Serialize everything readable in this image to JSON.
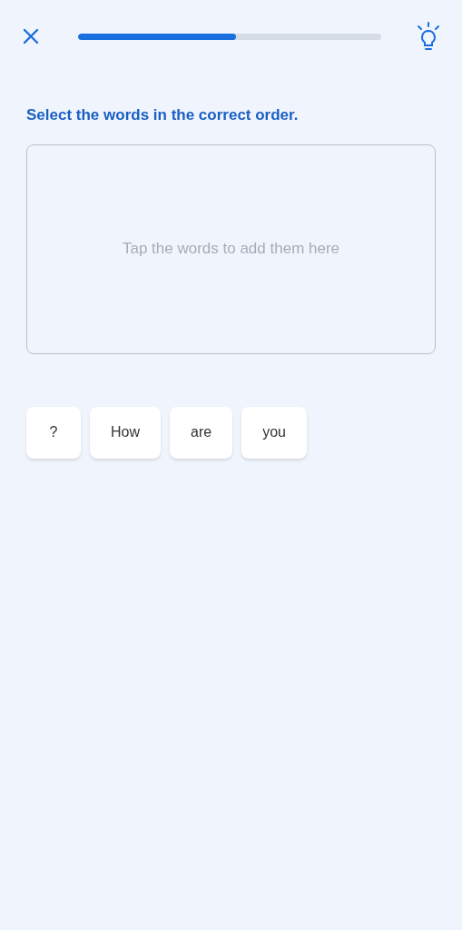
{
  "progress": {
    "level": 0.52
  },
  "instruction": "Select the words in the correct order.",
  "answer_area": {
    "placeholder": "Tap the words to add them here"
  },
  "word_bank": [
    {
      "label": "?"
    },
    {
      "label": "How"
    },
    {
      "label": "are"
    },
    {
      "label": "you"
    }
  ]
}
